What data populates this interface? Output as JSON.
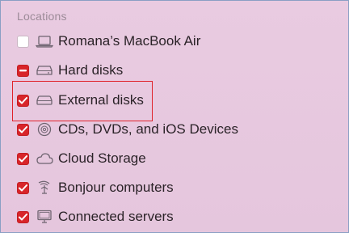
{
  "section": {
    "title": "Locations"
  },
  "items": [
    {
      "label": "Romana’s MacBook Air",
      "state": "unchecked",
      "icon": "laptop-icon"
    },
    {
      "label": "Hard disks",
      "state": "mixed",
      "icon": "hard-disk-icon"
    },
    {
      "label": "External disks",
      "state": "checked",
      "icon": "external-disk-icon"
    },
    {
      "label": "CDs, DVDs, and iOS Devices",
      "state": "checked",
      "icon": "optical-disc-icon"
    },
    {
      "label": "Cloud Storage",
      "state": "checked",
      "icon": "cloud-icon"
    },
    {
      "label": "Bonjour computers",
      "state": "checked",
      "icon": "bonjour-icon"
    },
    {
      "label": "Connected servers",
      "state": "checked",
      "icon": "server-display-icon"
    }
  ],
  "colors": {
    "checkbox_on": "#d8252a",
    "highlight_border": "#e0232b",
    "background": "#e6c8df"
  }
}
